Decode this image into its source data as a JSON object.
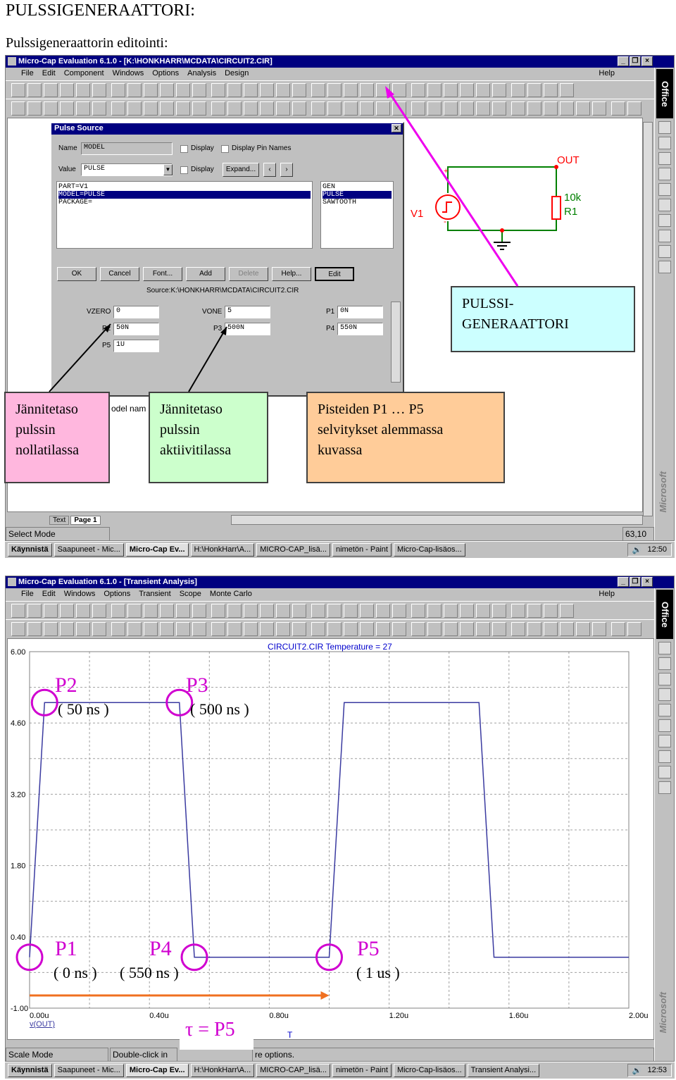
{
  "page": {
    "heading": "PULSSIGENERAATTORI:",
    "subheading": "Pulssigeneraattorin editointi:"
  },
  "win1": {
    "title": "Micro-Cap Evaluation 6.1.0 - [K:\\HONKHARR\\MCDATA\\CIRCUIT2.CIR]",
    "menu": [
      "File",
      "Edit",
      "Component",
      "Windows",
      "Options",
      "Analysis",
      "Design"
    ],
    "help": "Help",
    "dialog": {
      "title": "Pulse Source",
      "name_label": "Name",
      "name_value": "MODEL",
      "value_label": "Value",
      "value_value": "PULSE",
      "display1": "Display",
      "display_pin": "Display Pin Names",
      "display2": "Display",
      "expand": "Expand...",
      "attributes": [
        "PART=V1",
        "MODEL=PULSE",
        "PACKAGE="
      ],
      "models": [
        "GEN",
        "PULSE",
        "SAWTOOTH"
      ],
      "buttons": [
        "OK",
        "Cancel",
        "Font...",
        "Add",
        "Delete",
        "Help...",
        "Edit"
      ],
      "source": "Source:K:\\HONKHARR\\MCDATA\\CIRCUIT2.CIR",
      "params": {
        "vzero_l": "VZERO",
        "vzero": "0",
        "vone_l": "VONE",
        "vone": "5",
        "p1_l": "P1",
        "p1": "0N",
        "p2_l": "P2",
        "p2": "50N",
        "p3_l": "P3",
        "p3": "500N",
        "p4_l": "P4",
        "p4": "550N",
        "p5_l": "P5",
        "p5": "1U"
      },
      "model_name_partial": "odel nam"
    },
    "circuit": {
      "out": "OUT",
      "v1": "V1",
      "r_value": "10k",
      "r_name": "R1",
      "plus": "+",
      "minus": "-"
    },
    "tabs": [
      "Text",
      "Page 1"
    ],
    "status_left": "Select Mode",
    "status_right": "63,10"
  },
  "callouts": {
    "pulssi": "PULSSI-\nGENERAATTORI",
    "zero": "Jännitetaso\npulssin\nnollatilassa",
    "one": "Jännitetaso\npulssin\naktiivitilassa",
    "points": "Pisteiden P1 … P5\nselvitykset alemmassa\nkuvassa"
  },
  "taskbar1": {
    "start": "Käynnistä",
    "items": [
      "Saapuneet - Mic...",
      "Micro-Cap Ev...",
      "H:\\HonkHarr\\A...",
      "MICRO-CAP_lisä...",
      "nimetön - Paint",
      "Micro-Cap-lisäos..."
    ],
    "clock": "12:50"
  },
  "win2": {
    "title": "Micro-Cap Evaluation 6.1.0 - [Transient Analysis]",
    "menu": [
      "File",
      "Edit",
      "Windows",
      "Options",
      "Transient",
      "Scope",
      "Monte Carlo"
    ],
    "help": "Help",
    "plot_title": "CIRCUIT2.CIR Temperature = 27",
    "trace_label": "v(OUT)",
    "x_axis_letter": "T",
    "status_left": "Scale Mode",
    "status_mid": "Double-click in",
    "status_right": "re options."
  },
  "annotations": {
    "p1": "P1",
    "p1v": "( 0 ns )",
    "p2": "P2",
    "p2v": "( 50 ns )",
    "p3": "P3",
    "p3v": "( 500 ns )",
    "p4": "P4",
    "p4v": "( 550 ns )",
    "p5": "P5",
    "p5v": "( 1 us )",
    "tau": "τ = P5"
  },
  "taskbar2": {
    "start": "Käynnistä",
    "items": [
      "Saapuneet - Mic...",
      "Micro-Cap Ev...",
      "H:\\HonkHarr\\A...",
      "MICRO-CAP_lisä...",
      "nimetön - Paint",
      "Micro-Cap-lisäos...",
      "Transient Analysi..."
    ],
    "clock": "12:53"
  },
  "office": {
    "logo": "Office",
    "ms": "Microsoft"
  },
  "colors": {
    "trace": "#3a3aa0",
    "marker": "#d000d0",
    "arrow": "#f07020",
    "circuit_wire": "#008000",
    "circuit_part": "#ff0000"
  },
  "chart_data": {
    "type": "line",
    "title": "CIRCUIT2.CIR Temperature = 27",
    "xlabel": "T",
    "ylabel": "v(OUT)",
    "xlim": [
      0,
      2.0
    ],
    "ylim": [
      -1.0,
      6.0
    ],
    "x_ticks": [
      "0.00u",
      "0.40u",
      "0.80u",
      "1.20u",
      "1.60u",
      "2.00u"
    ],
    "y_ticks": [
      "6.00",
      "4.60",
      "3.20",
      "1.80",
      "0.40",
      "-1.00"
    ],
    "series": [
      {
        "x": [
          0,
          0.05,
          0.5,
          0.55,
          1.0,
          1.05,
          1.5,
          1.55,
          2.0
        ],
        "y": [
          0,
          5,
          5,
          0,
          0,
          5,
          5,
          0,
          0
        ]
      }
    ]
  }
}
